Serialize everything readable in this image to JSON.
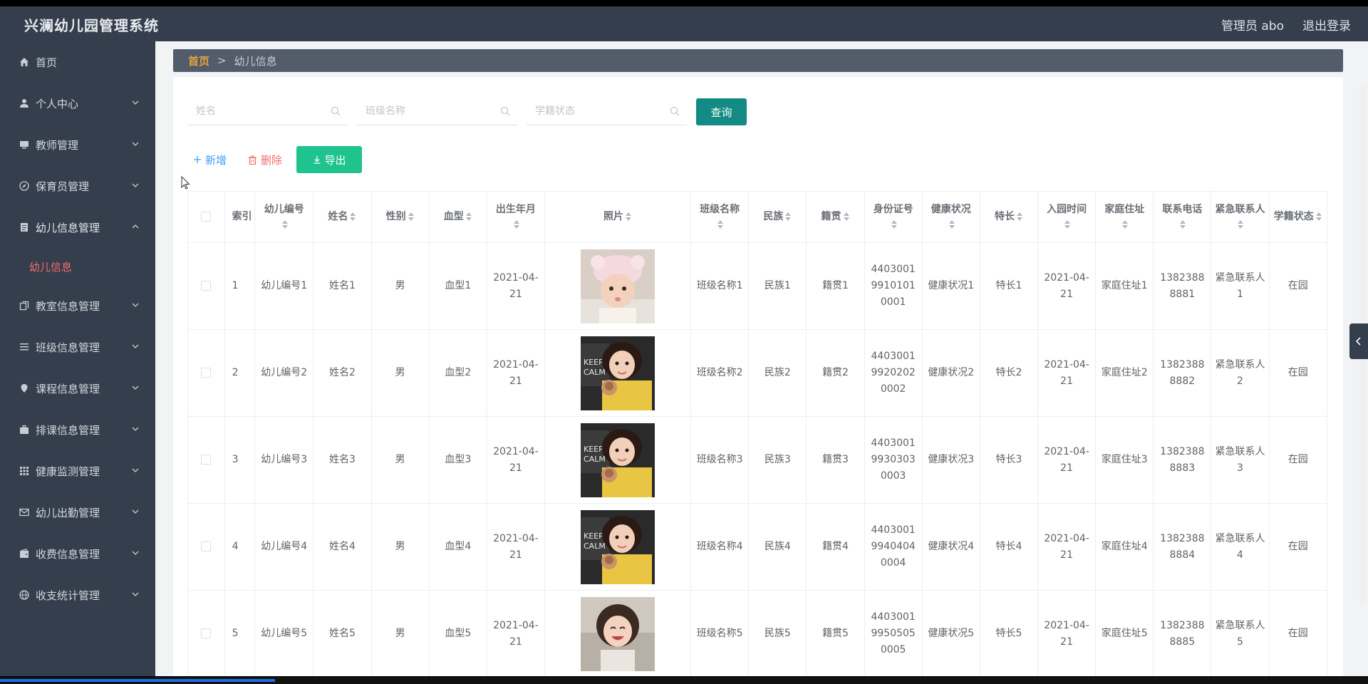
{
  "app": {
    "title": "兴澜幼儿园管理系统",
    "user_label": "管理员 abo",
    "logout_label": "退出登录"
  },
  "sidebar": {
    "items": [
      {
        "label": "首页",
        "icon": "home-icon",
        "expandable": false
      },
      {
        "label": "个人中心",
        "icon": "user-icon",
        "expandable": true
      },
      {
        "label": "教师管理",
        "icon": "monitor-icon",
        "expandable": true
      },
      {
        "label": "保育员管理",
        "icon": "compass-icon",
        "expandable": true
      },
      {
        "label": "幼儿信息管理",
        "icon": "document-icon",
        "expandable": true,
        "expanded": true
      },
      {
        "label": "幼儿信息",
        "sub": true,
        "active": true
      },
      {
        "label": "教室信息管理",
        "icon": "copy-icon",
        "expandable": true
      },
      {
        "label": "班级信息管理",
        "icon": "list-icon",
        "expandable": true
      },
      {
        "label": "课程信息管理",
        "icon": "location-icon",
        "expandable": true
      },
      {
        "label": "排课信息管理",
        "icon": "suitcase-icon",
        "expandable": true
      },
      {
        "label": "健康监测管理",
        "icon": "grid-icon",
        "expandable": true
      },
      {
        "label": "幼儿出勤管理",
        "icon": "message-icon",
        "expandable": true
      },
      {
        "label": "收费信息管理",
        "icon": "wallet-icon",
        "expandable": true
      },
      {
        "label": "收支统计管理",
        "icon": "globe-icon",
        "expandable": true
      }
    ]
  },
  "breadcrumb": {
    "home": "首页",
    "separator": ">",
    "current": "幼儿信息"
  },
  "search": {
    "name_placeholder": "姓名",
    "class_placeholder": "班级名称",
    "status_placeholder": "学籍状态",
    "query_label": "查询"
  },
  "actions": {
    "add_label": "新增",
    "delete_label": "删除",
    "export_label": "导出"
  },
  "table": {
    "headers": {
      "index": "索引",
      "child_no": "幼儿编号",
      "name": "姓名",
      "gender": "性别",
      "blood": "血型",
      "birth": "出生年月",
      "photo": "照片",
      "class_name": "班级名称",
      "ethnicity": "民族",
      "native": "籍贯",
      "id_no": "身份证号",
      "health": "健康状况",
      "specialty": "特长",
      "enroll": "入园时间",
      "address": "家庭住址",
      "phone": "联系电话",
      "emergency": "紧急联系人",
      "status": "学籍状态"
    },
    "rows": [
      {
        "index": "1",
        "child_no": "幼儿编号1",
        "name": "姓名1",
        "gender": "男",
        "blood": "血型1",
        "birth": "2021-04-21",
        "photo": "photo-girl-hat",
        "class_name": "班级名称1",
        "ethnicity": "民族1",
        "native": "籍贯1",
        "id_no": "440300199101010001",
        "health": "健康状况1",
        "specialty": "特长1",
        "enroll": "2021-04-21",
        "address": "家庭住址1",
        "phone": "13823888881",
        "emergency": "紧急联系人1",
        "status": "在园"
      },
      {
        "index": "2",
        "child_no": "幼儿编号2",
        "name": "姓名2",
        "gender": "男",
        "blood": "血型2",
        "birth": "2021-04-21",
        "photo": "photo-girl-doll",
        "class_name": "班级名称2",
        "ethnicity": "民族2",
        "native": "籍贯2",
        "id_no": "440300199202020002",
        "health": "健康状况2",
        "specialty": "特长2",
        "enroll": "2021-04-21",
        "address": "家庭住址2",
        "phone": "13823888882",
        "emergency": "紧急联系人2",
        "status": "在园"
      },
      {
        "index": "3",
        "child_no": "幼儿编号3",
        "name": "姓名3",
        "gender": "男",
        "blood": "血型3",
        "birth": "2021-04-21",
        "photo": "photo-girl-doll",
        "class_name": "班级名称3",
        "ethnicity": "民族3",
        "native": "籍贯3",
        "id_no": "440300199303030003",
        "health": "健康状况3",
        "specialty": "特长3",
        "enroll": "2021-04-21",
        "address": "家庭住址3",
        "phone": "13823888883",
        "emergency": "紧急联系人3",
        "status": "在园"
      },
      {
        "index": "4",
        "child_no": "幼儿编号4",
        "name": "姓名4",
        "gender": "男",
        "blood": "血型4",
        "birth": "2021-04-21",
        "photo": "photo-girl-doll",
        "class_name": "班级名称4",
        "ethnicity": "民族4",
        "native": "籍贯4",
        "id_no": "440300199404040004",
        "health": "健康状况4",
        "specialty": "特长4",
        "enroll": "2021-04-21",
        "address": "家庭住址4",
        "phone": "13823888884",
        "emergency": "紧急联系人4",
        "status": "在园"
      },
      {
        "index": "5",
        "child_no": "幼儿编号5",
        "name": "姓名5",
        "gender": "男",
        "blood": "血型5",
        "birth": "2021-04-21",
        "photo": "photo-girl-laughing",
        "class_name": "班级名称5",
        "ethnicity": "民族5",
        "native": "籍贯5",
        "id_no": "440300199505050005",
        "health": "健康状况5",
        "specialty": "特长5",
        "enroll": "2021-04-21",
        "address": "家庭住址5",
        "phone": "13823888885",
        "emergency": "紧急联系人5",
        "status": "在园"
      }
    ]
  },
  "colors": {
    "topbar": "#343e4c",
    "sidebar": "#343e4c",
    "active_sub": "#f56c6c",
    "breadcrumb_home": "#e6a23c",
    "query_button": "#138a83",
    "export_button": "#1ec38d",
    "add_text": "#409eff",
    "delete_text": "#f56c6c"
  }
}
